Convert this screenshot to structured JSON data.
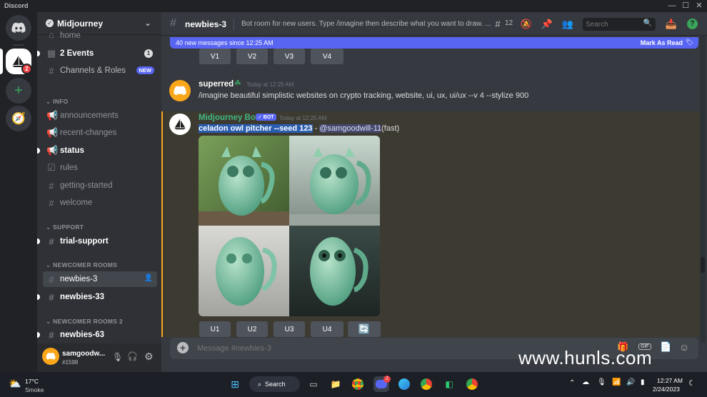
{
  "window": {
    "title": "Discord",
    "controls": [
      "—",
      "☐",
      "✕"
    ]
  },
  "servers": {
    "notification_count": "2"
  },
  "guild": {
    "name": "Midjourney"
  },
  "channels": {
    "partial_top": "home",
    "events": {
      "label": "2 Events",
      "badge": "1"
    },
    "roles": {
      "label": "Channels & Roles",
      "badge": "NEW"
    },
    "info_category": "INFO",
    "info": [
      {
        "label": "announcements",
        "icon": "📢"
      },
      {
        "label": "recent-changes",
        "icon": "📢"
      },
      {
        "label": "status",
        "icon": "📢"
      },
      {
        "label": "rules",
        "icon": "☑"
      },
      {
        "label": "getting-started",
        "icon": "#"
      },
      {
        "label": "welcome",
        "icon": "#"
      }
    ],
    "support_category": "SUPPORT",
    "support": [
      {
        "label": "trial-support"
      }
    ],
    "newcomer_category": "NEWCOMER ROOMS",
    "newcomer": [
      {
        "label": "newbies-3"
      },
      {
        "label": "newbies-33"
      }
    ],
    "newcomer2_category": "NEWCOMER ROOMS 2",
    "newcomer2": [
      {
        "label": "newbies-63"
      }
    ]
  },
  "user": {
    "name": "samgoodw...",
    "tag": "#1598"
  },
  "header": {
    "channel": "newbies-3",
    "topic": "Bot room for new users. Type /imagine then describe what you want to draw. ...",
    "threads": "12",
    "search_placeholder": "Search"
  },
  "banner": {
    "text": "40 new messages since 12:25 AM",
    "action": "Mark As Read"
  },
  "variation_buttons": [
    "V1",
    "V2",
    "V3",
    "V4"
  ],
  "message1": {
    "author": "superred",
    "timestamp": "Today at 12:25 AM",
    "text": "/imagine beautiful simplistic websites on crypto tracking, website, ui, ux, ui/ux --v 4 --stylize 900"
  },
  "message2": {
    "author": "Midjourney Bot",
    "bot_tag": "✓ BOT",
    "timestamp": "Today at 12:25 AM",
    "prompt": "celadon owl pitcher --seed 123",
    "sep": " - ",
    "mention": "@samgoodwill-11",
    "speed": "(fast)"
  },
  "upscale_buttons": [
    "U1",
    "U2",
    "U3",
    "U4"
  ],
  "composer": {
    "placeholder": "Message #newbies-3"
  },
  "watermark": "www.hunls.com",
  "taskbar": {
    "weather_temp": "17°C",
    "weather_text": "Smoke",
    "search": "Search",
    "time": "12:27 AM",
    "date": "2/24/2023"
  },
  "colors": {
    "accent": "#5865f2",
    "bot_green": "#43b581",
    "mention": "#dee0fc",
    "highlight": "#2a5db0"
  }
}
